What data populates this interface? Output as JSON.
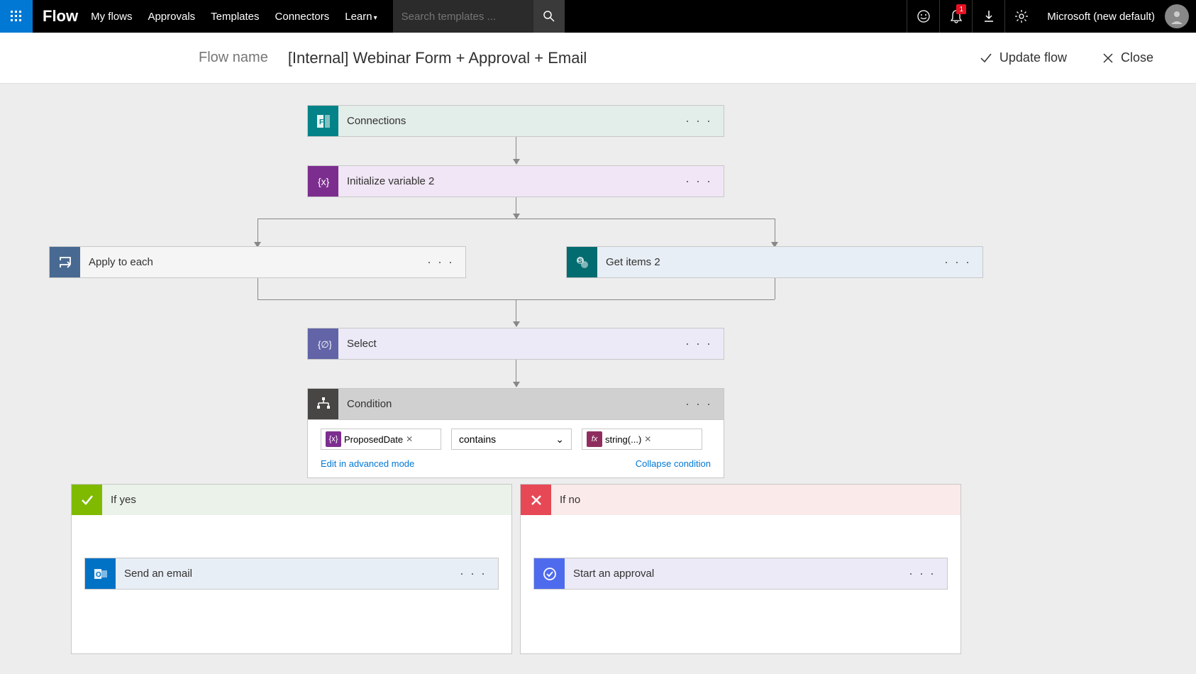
{
  "topbar": {
    "brand": "Flow",
    "nav": [
      "My flows",
      "Approvals",
      "Templates",
      "Connectors",
      "Learn"
    ],
    "search_placeholder": "Search templates ...",
    "notification_count": "1",
    "tenant": "Microsoft (new default)"
  },
  "subheader": {
    "label": "Flow name",
    "value": "[Internal] Webinar Form + Approval + Email",
    "update": "Update flow",
    "close": "Close"
  },
  "cards": {
    "connections": "Connections",
    "initvar": "Initialize variable 2",
    "apply": "Apply to each",
    "getitems": "Get items 2",
    "select": "Select",
    "condition": "Condition",
    "ifyes": "If yes",
    "ifno": "If no",
    "sendemail": "Send an email",
    "startapproval": "Start an approval"
  },
  "condition": {
    "left_token": "ProposedDate",
    "operator": "contains",
    "right_token": "string(...)",
    "edit_link": "Edit in advanced mode",
    "collapse_link": "Collapse condition"
  },
  "menu_dots": "· · ·"
}
